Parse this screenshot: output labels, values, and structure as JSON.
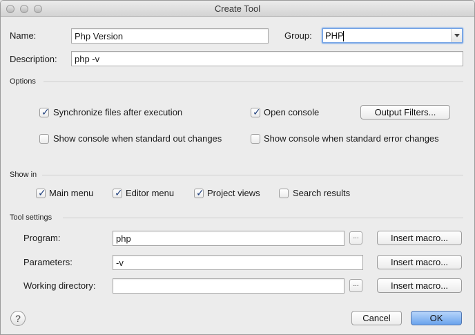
{
  "window": {
    "title": "Create Tool"
  },
  "form": {
    "name_label": "Name:",
    "name_value": "Php Version",
    "group_label": "Group:",
    "group_value": "PHP",
    "description_label": "Description:",
    "description_value": "php -v"
  },
  "options": {
    "section_label": "Options",
    "synchronize_label": "Synchronize files after execution",
    "synchronize_checked": true,
    "open_console_label": "Open console",
    "open_console_checked": true,
    "output_filters_label": "Output Filters...",
    "show_console_stdout_label": "Show console when standard out changes",
    "show_console_stdout_checked": false,
    "show_console_stderr_label": "Show console when standard error changes",
    "show_console_stderr_checked": false
  },
  "show_in": {
    "section_label": "Show in",
    "main_menu_label": "Main menu",
    "main_menu_checked": true,
    "editor_menu_label": "Editor menu",
    "editor_menu_checked": true,
    "project_views_label": "Project views",
    "project_views_checked": true,
    "search_results_label": "Search results",
    "search_results_checked": false
  },
  "tool_settings": {
    "section_label": "Tool settings",
    "program_label": "Program:",
    "program_value": "php",
    "parameters_label": "Parameters:",
    "parameters_value": "-v",
    "working_directory_label": "Working directory:",
    "working_directory_value": "",
    "browse_label": "...",
    "insert_macro_label": "Insert macro..."
  },
  "footer": {
    "help_label": "?",
    "cancel_label": "Cancel",
    "ok_label": "OK"
  },
  "colors": {
    "focus_ring": "#7aa7e6",
    "primary_button": "#6aa3ec",
    "check_mark": "#1b3c7a"
  },
  "icons": {
    "window_close": "close-icon",
    "window_minimize": "minimize-icon",
    "window_zoom": "zoom-icon",
    "dropdown": "chevron-down-icon",
    "check": "checkmark-icon",
    "help": "help-icon"
  }
}
